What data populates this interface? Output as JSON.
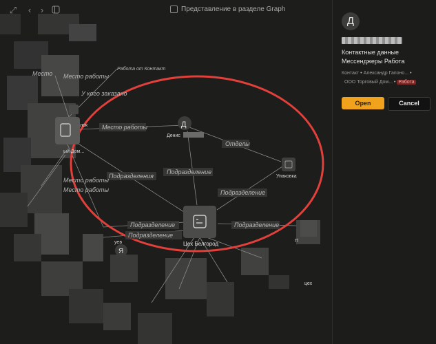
{
  "toolbar": {
    "expand_icon": "expand-icon",
    "back_icon": "chevron-left-icon",
    "forward_icon": "chevron-right-icon",
    "sidebar_icon": "sidebar-toggle-icon",
    "graph_toggle_label": "Представление в разделе Graph"
  },
  "graph": {
    "nodes": {
      "person_initial": "Д",
      "person_label": "Денис",
      "packaging_label": "Упаковка",
      "workshop_label": "Цех Белгород",
      "left_node_label_a": "лок",
      "left_node_label_b": "ый Дом...",
      "bottom_left_initial": "Я",
      "bottom_left_label": "уев",
      "right_node_label": "П",
      "right_bottom_label": "цех"
    },
    "edges": {
      "place_of_work": "Место работы",
      "departments": "Отделы",
      "subdivision": "Подразделение",
      "ordered_from": "У кого заказано",
      "place_of_work_top": "Место работы",
      "place_top": "Место",
      "top_cut": "Работа от Контакт",
      "subdivision_left": "Подразделения",
      "subdivision_bottom_a": "Подразделение",
      "subdivision_bottom_b": "Подразделение",
      "place_of_work_left_a": "Место работы",
      "place_of_work_left_b": "Место работы"
    }
  },
  "panel": {
    "avatar_initial": "Д",
    "contact_data": "Контактные данные",
    "messengers_work": "Мессенджеры Работа",
    "meta_contact": "Контакт",
    "meta_person": "Александр Гапоно...",
    "meta_company": "ООО Торговый Дом...",
    "meta_tag": "Работа",
    "open_label": "Open",
    "cancel_label": "Cancel"
  },
  "colors": {
    "accent": "#f0a21c",
    "highlight_circle": "#e2403a",
    "edge_label_bg": "#393938",
    "tag_red": "#7a2624"
  }
}
